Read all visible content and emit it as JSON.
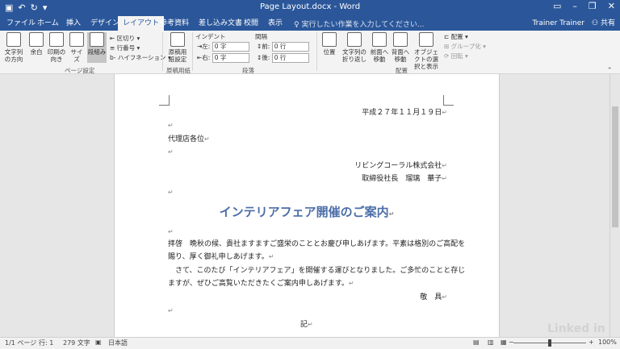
{
  "titlebar": {
    "save_icon": "save-icon",
    "undo_icon": "undo-icon",
    "redo_icon": "redo-icon",
    "customize_icon": "customize-qat-icon",
    "title": "Page Layout.docx - Word",
    "ribbon_display_icon": "ribbon-display-icon",
    "minimize": "–",
    "restore": "❐",
    "close": "✕"
  },
  "tabs": [
    "ファイル",
    "ホーム",
    "挿入",
    "デザイン",
    "レイアウト",
    "参考資料",
    "差し込み文書",
    "校閲",
    "表示"
  ],
  "active_tab": "レイアウト",
  "tell_me": "実行したい作業を入力してください...",
  "user": "Trainer Trainer",
  "share": "共有",
  "ribbon": {
    "page_setup": {
      "group_label": "ページ設定",
      "text_direction": "文字列の方向",
      "margins": "余白",
      "orientation": "印刷の向き",
      "size": "サイズ",
      "columns": "段組み",
      "breaks": "区切り",
      "line_numbers": "行番号",
      "hyphenation": "ハイフネーション"
    },
    "manuscript": {
      "group_label": "原稿用紙",
      "settings": "原稿用紙設定"
    },
    "paragraph": {
      "group_label": "段落",
      "indent_label": "インデント",
      "spacing_label": "間隔",
      "left_label": "左:",
      "left_value": "0 字",
      "right_label": "右:",
      "right_value": "0 字",
      "before_label": "前:",
      "before_value": "0 行",
      "after_label": "後:",
      "after_value": "0 行"
    },
    "arrange": {
      "group_label": "配置",
      "position": "位置",
      "wrap_text": "文字列の折り返し",
      "bring_forward": "前面へ移動",
      "send_backward": "背面へ移動",
      "selection_pane": "オブジェクトの選択と表示",
      "align": "配置",
      "group": "グループ化",
      "rotate": "回転"
    }
  },
  "document": {
    "date": "平成２７年１１月１９日",
    "addressee": "代理店各位",
    "company": "リビングコーラル株式会社",
    "sender": "取締役社長　瑠璃　華子",
    "heading": "インテリアフェア開催のご案内",
    "body_line1": "拝啓　晩秋の候、貴社ますますご盛栄のこととお慶び申しあげます。平素は格別のご高配を",
    "body_line2": "賜り、厚く御礼申しあげます。",
    "body_line3": "　さて、このたび「インテリアフェア」を開催する運びとなりました。ご多忙のことと存じ",
    "body_line4": "ますが、ぜひご高覧いただきたくご案内申しあげます。",
    "closing": "敬　具",
    "note": "記"
  },
  "status": {
    "page": "1/1 ページ",
    "line": "行: 1",
    "words": "279 文字",
    "language": "日本語",
    "zoom": "100%"
  },
  "watermark": "Linked in"
}
